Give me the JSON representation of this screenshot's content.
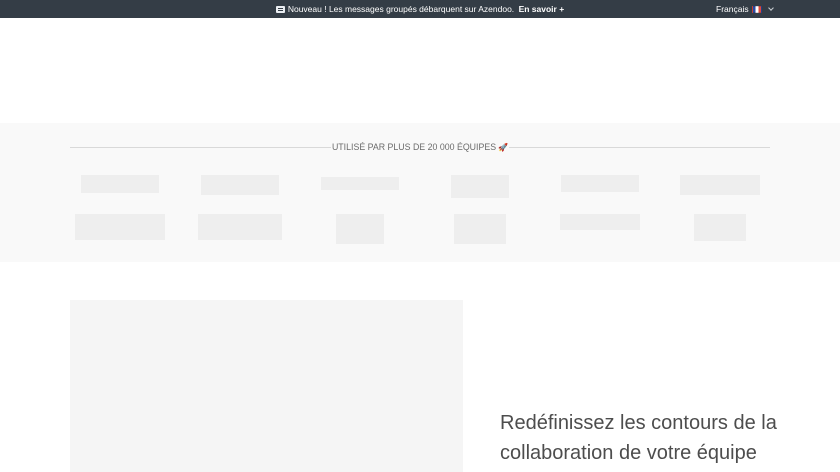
{
  "announcement": {
    "icon": "chat-bubble-icon",
    "text": "Nouveau ! Les messages groupés débarquent sur Azendoo.",
    "link_label": "En savoir +"
  },
  "language": {
    "current": "Français",
    "flag_icon": "flag-fr-icon"
  },
  "logos_section": {
    "heading": "UTILISÉ PAR PLUS DE 20 000 ÉQUIPES",
    "heading_icon": "rocket-icon"
  },
  "hero": {
    "title": "Redéfinissez les contours de la collaboration de votre équipe"
  },
  "colors": {
    "topbar_bg": "#343d46",
    "logos_bg": "#f9f9f9",
    "placeholder": "#eeeeee",
    "hero_text": "#4d4d4d"
  }
}
